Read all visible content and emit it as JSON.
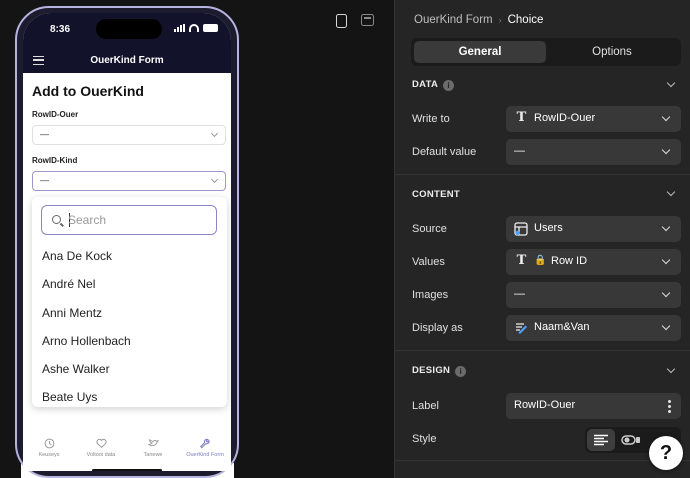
{
  "canvas": {
    "device_options": [
      "phone-icon",
      "tablet-icon"
    ],
    "phone": {
      "status_time": "8:36",
      "app_title": "OuerKind Form",
      "form_title": "Add to OuerKind",
      "fields": [
        {
          "label": "RowID-Ouer",
          "value": "—"
        },
        {
          "label": "RowID-Kind",
          "value": "—"
        }
      ],
      "dropdown": {
        "search_placeholder": "Search",
        "options": [
          "Ana De Kock",
          "André Nel",
          "Anni Mentz",
          "Arno Hollenbach",
          "Ashe Walker",
          "Beate Uys"
        ]
      },
      "tabbar": [
        {
          "label": "Keuseys",
          "icon": "clock-icon",
          "active": false
        },
        {
          "label": "Voltooi data",
          "icon": "heart-icon",
          "active": false
        },
        {
          "label": "Tanewe",
          "icon": "bird-icon",
          "active": false
        },
        {
          "label": "OuerKind Form",
          "icon": "wrench-icon",
          "active": true
        }
      ],
      "accent": "#7d79c4"
    }
  },
  "panel": {
    "breadcrumb": {
      "parent": "OuerKind Form",
      "current": "Choice"
    },
    "tabs": {
      "general": "General",
      "options": "Options"
    },
    "data": {
      "heading": "DATA",
      "write_to_label": "Write to",
      "write_to_value": "RowID-Ouer",
      "default_label": "Default value",
      "default_value": "—"
    },
    "content": {
      "heading": "CONTENT",
      "source_label": "Source",
      "source_value": "Users",
      "values_label": "Values",
      "values_value": "Row ID",
      "images_label": "Images",
      "images_value": "—",
      "display_label": "Display as",
      "display_value": "Naam&Van"
    },
    "design": {
      "heading": "DESIGN",
      "label_label": "Label",
      "label_value": "RowID-Ouer",
      "style_label": "Style"
    },
    "help": "?"
  }
}
